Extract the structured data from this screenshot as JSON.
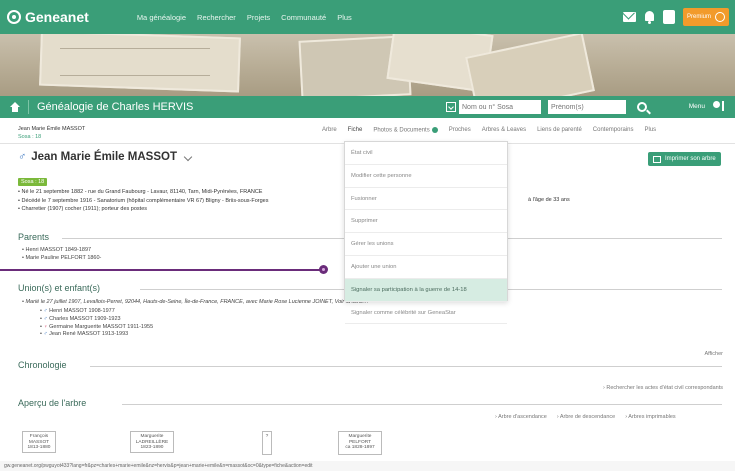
{
  "topnav": {
    "logo": "Geneanet",
    "menu": [
      "Ma généalogie",
      "Rechercher",
      "Projets",
      "Communauté",
      "Plus"
    ],
    "premium_label": "Premium"
  },
  "treebar": {
    "title": "Généalogie de Charles HERVIS",
    "search_sosa_placeholder": "Nom ou n° Sosa",
    "firstname_placeholder": "Prénom(s)",
    "menu_label": "Menu"
  },
  "breadcrumb": {
    "name": "Jean Marie Émile MASSOT",
    "sosa": "Sosa : 18"
  },
  "tabs": [
    "Arbre",
    "Fiche",
    "Photos & Documents",
    "Proches",
    "Arbres & Leaves",
    "Liens de parenté",
    "Contemporains",
    "Plus"
  ],
  "person": {
    "name": "Jean Marie Émile MASSOT",
    "print_label": "Imprimer son arbre",
    "sosa_badge": "Sosa : 18",
    "facts": [
      "Né le 21 septembre 1882 - rue du Grand Faubourg - Lavaur, 81140, Tarn, Midi-Pyrénées, FRANCE",
      "Décédé le 7 septembre 1916 - Sanatorium (hôpital complémentaire VR 67) Bligny - Briis-sous-Forges",
      "Charretier (1907) cocher (1911); porteur des postes"
    ],
    "age_note": "à l'âge de 33 ans"
  },
  "sections": {
    "parents": "Parents",
    "unions": "Union(s) et enfant(s)",
    "chronology": "Chronologie",
    "tree_preview": "Aperçu de l'arbre"
  },
  "parents": [
    "Henri MASSOT 1849-1897",
    "Marie Pauline PELFORT 1860-"
  ],
  "union": {
    "line": "Marié le 27 juillet 1907, Levallois-Perret, 92044, Hauts-de-Seine, Île-de-France, FRANCE, avec Marie Rose Lucienne JOINET, Voir la fiche…",
    "children": [
      {
        "sym": "♂",
        "text": "Henri MASSOT 1908-1977"
      },
      {
        "sym": "♂",
        "text": "Charles MASSOT 1909-1923"
      },
      {
        "sym": "♀",
        "text": "Germaine Marguerite MASSOT 1911-1955"
      },
      {
        "sym": "♂",
        "text": "Jean René MASSOT 1913-1993"
      }
    ]
  },
  "chronology": {
    "small_link": "Afficher",
    "link": "Rechercher les actes d'état civil correspondants"
  },
  "tree_links": [
    "Arbre d'ascendance",
    "Arbre de descendance",
    "Arbres imprimables"
  ],
  "tree_boxes": [
    {
      "name": "François MASSOT",
      "dates": "1813-1880"
    },
    {
      "name": "Marguerite LADREILLÈRE",
      "dates": "1823-1890"
    },
    {
      "name": "?",
      "dates": ""
    },
    {
      "name": "Marguerite PELFORT",
      "dates": "ca 1828-1897"
    }
  ],
  "url": "gw.geneanet.org/pwguyot433?lang=fr&pz=charles+marie+emile&nz=hervis&p=jean+marie+emile&n=massot&oc=0&type=fiche&action=edit",
  "dropdown": [
    "État civil",
    "Modifier cette personne",
    "Fusionner",
    "Supprimer",
    "Gérer les unions",
    "Ajouter une union",
    "Signaler sa participation à la guerre de 14-18",
    "Signaler comme célébrité sur GeneaStar"
  ],
  "colors": {
    "brand_green": "#3a9e78",
    "highlight": "#d6ece2",
    "callout": "#6a2c7a",
    "premium": "#f29b2b"
  }
}
